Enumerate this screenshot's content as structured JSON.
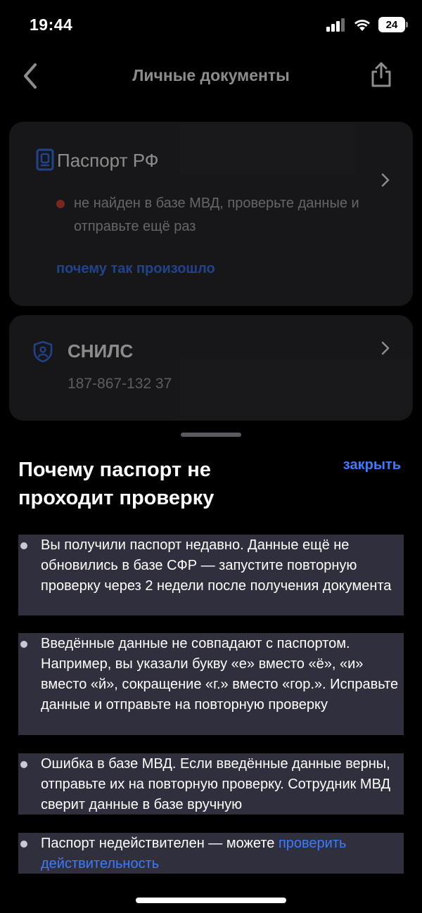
{
  "status_bar": {
    "time": "19:44",
    "battery": "24",
    "icons": [
      "cellular-signal-icon",
      "wifi-icon",
      "battery-icon"
    ]
  },
  "nav": {
    "title": "Личные документы",
    "icons": [
      "back-chevron-icon",
      "share-icon"
    ]
  },
  "documents": [
    {
      "title": "Паспорт РФ",
      "icon": "passport-icon",
      "status_text": "не найден в базе МВД, проверьте данные и отправьте ещё раз",
      "status_color": "#e0443a",
      "link": "почему так произошло"
    },
    {
      "title": "СНИЛС",
      "icon": "shield-person-icon",
      "number": "187-867-132 37"
    }
  ],
  "sheet": {
    "title": "Почему паспорт не проходит проверку",
    "close_label": "закрыть",
    "reasons": [
      {
        "text": "Вы получили паспорт недавно. Данные ещё не обновились в базе СФР — запустите повторную проверку через 2 недели после получения документа"
      },
      {
        "text": "Введённые данные не совпадают с паспортом. Например, вы указали букву «е» вместо «ё», «и» вместо «й», сокращение «г.» вместо «гор.». Исправьте данные и отправьте на повторную проверку"
      },
      {
        "text": "Ошибка в базе МВД. Если введённые данные верны, отправьте их на повторную проверку. Сотрудник МВД сверит данные в базе вручную"
      },
      {
        "text": "Паспорт недействителен — можете ",
        "link": "проверить действительность"
      }
    ]
  },
  "colors": {
    "accent": "#3b7bff",
    "card_bg": "#2b2b30",
    "highlight_bg": "#2f2f3d",
    "error": "#e0443a"
  }
}
